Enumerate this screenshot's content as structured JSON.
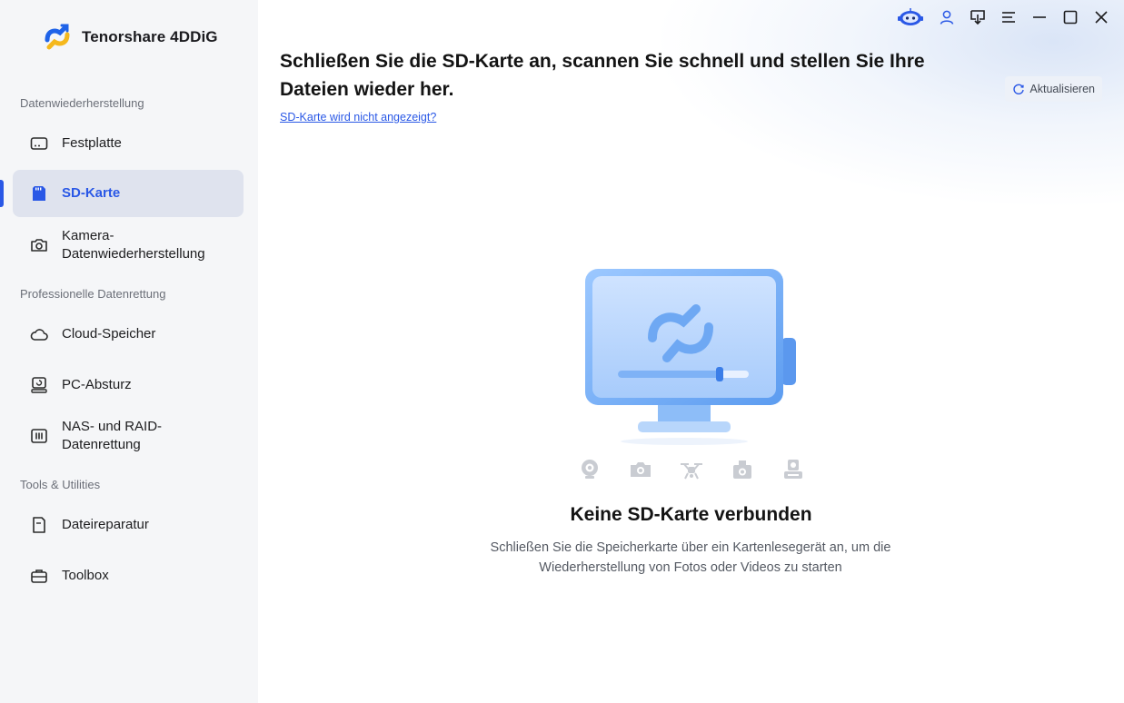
{
  "app": {
    "name": "Tenorshare 4DDiG"
  },
  "sidebar": {
    "sections": [
      {
        "label": "Datenwiederherstellung",
        "items": [
          {
            "label": "Festplatte",
            "icon": "hard-drive-icon",
            "active": false
          },
          {
            "label": "SD-Karte",
            "icon": "sd-card-icon",
            "active": true
          },
          {
            "label": "Kamera-\nDatenwiederherstellung",
            "icon": "camera-icon",
            "active": false
          }
        ]
      },
      {
        "label": "Professionelle Datenrettung",
        "items": [
          {
            "label": "Cloud-Speicher",
            "icon": "cloud-icon",
            "active": false
          },
          {
            "label": "PC-Absturz",
            "icon": "pc-crash-icon",
            "active": false
          },
          {
            "label": "NAS- und RAID-\nDatenrettung",
            "icon": "nas-raid-icon",
            "active": false
          }
        ]
      },
      {
        "label": "Tools & Utilities",
        "items": [
          {
            "label": "Dateireparatur",
            "icon": "file-repair-icon",
            "active": false
          },
          {
            "label": "Toolbox",
            "icon": "toolbox-icon",
            "active": false
          }
        ]
      }
    ]
  },
  "window_controls": [
    "assistant-robot-icon",
    "account-icon",
    "download-icon",
    "menu-icon",
    "minimize-icon",
    "maximize-icon",
    "close-icon"
  ],
  "main": {
    "title": "Schließen Sie die SD-Karte an, scannen Sie schnell und stellen Sie Ihre Dateien wieder her.",
    "help_link": "SD-Karte wird nicht angezeigt?",
    "refresh_label": "Aktualisieren",
    "devices": [
      "webcam-icon",
      "camera-icon",
      "drone-icon",
      "action-camera-icon",
      "dashcam-icon"
    ],
    "empty_title": "Keine SD-Karte verbunden",
    "empty_description": "Schließen Sie die Speicherkarte über ein Kartenlesegerät an, um die Wiederherstellung von Fotos oder Videos zu starten"
  },
  "colors": {
    "accent": "#2a58e6",
    "sidebar_bg": "#f5f6f8",
    "active_item_bg": "#dfe3ee",
    "illustration_blue": "#6ea8f3"
  }
}
